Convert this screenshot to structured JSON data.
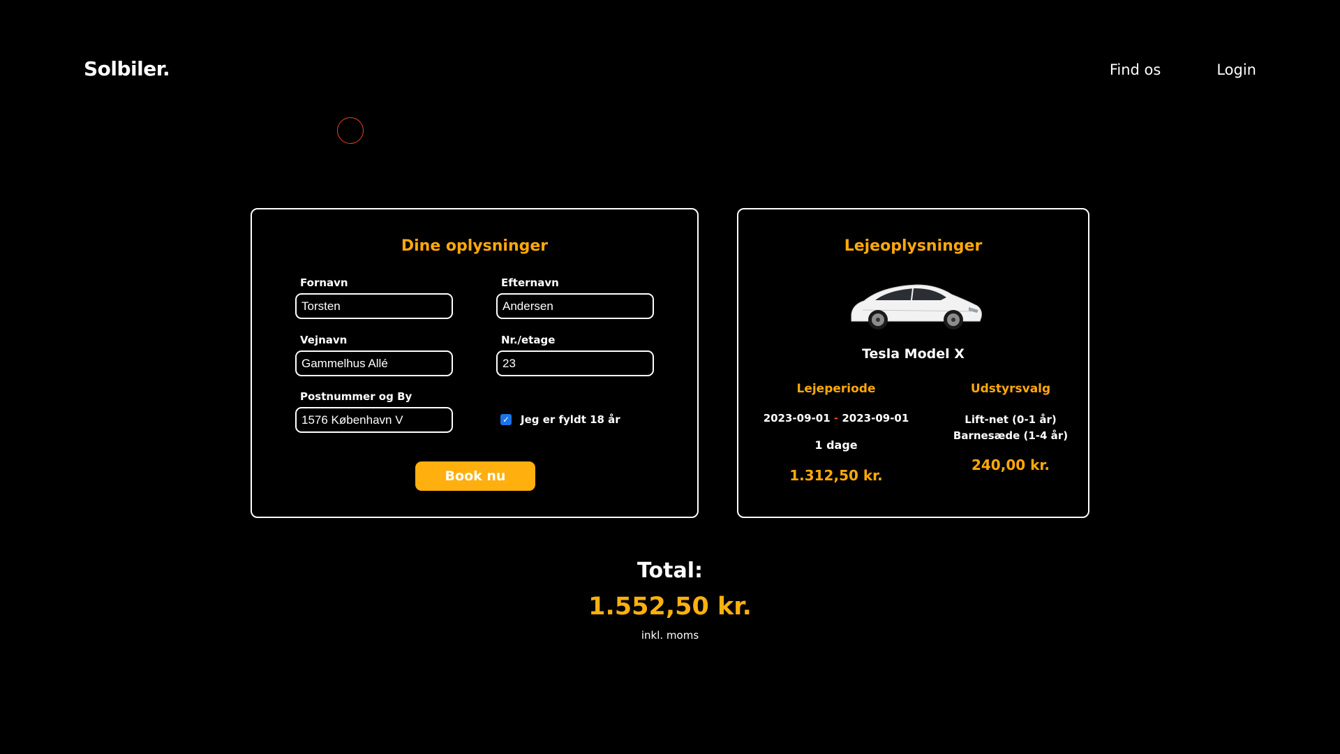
{
  "header": {
    "logo": "Solbiler.",
    "nav": [
      {
        "label": "Find os"
      },
      {
        "label": "Login"
      }
    ]
  },
  "customer_form": {
    "title": "Dine oplysninger",
    "fields": {
      "first_name": {
        "label": "Fornavn",
        "value": "Torsten"
      },
      "last_name": {
        "label": "Efternavn",
        "value": "Andersen"
      },
      "street": {
        "label": "Vejnavn",
        "value": "Gammelhus Allé"
      },
      "number": {
        "label": "Nr./etage",
        "value": "23"
      },
      "postal_city": {
        "label": "Postnummer og By",
        "value": "1576 København V"
      }
    },
    "age_checkbox": {
      "label": "Jeg er fyldt 18 år",
      "checked": true
    },
    "submit_label": "Book nu"
  },
  "rental": {
    "title": "Lejeoplysninger",
    "car_name": "Tesla Model X",
    "period": {
      "heading": "Lejeperiode",
      "start": "2023-09-01",
      "separator": "-",
      "end": "2023-09-01",
      "days": "1 dage",
      "price": "1.312,50 kr."
    },
    "equipment": {
      "heading": "Udstyrsvalg",
      "items": [
        "Lift-net (0-1 år)",
        "Barnesæde (1-4 år)"
      ],
      "price": "240,00 kr."
    }
  },
  "total": {
    "label": "Total:",
    "value": "1.552,50 kr.",
    "note": "inkl. moms"
  },
  "colors": {
    "background": "#000000",
    "accent": "#ffa90a",
    "button": "#ffb00e",
    "checkbox": "#1a73e8"
  }
}
